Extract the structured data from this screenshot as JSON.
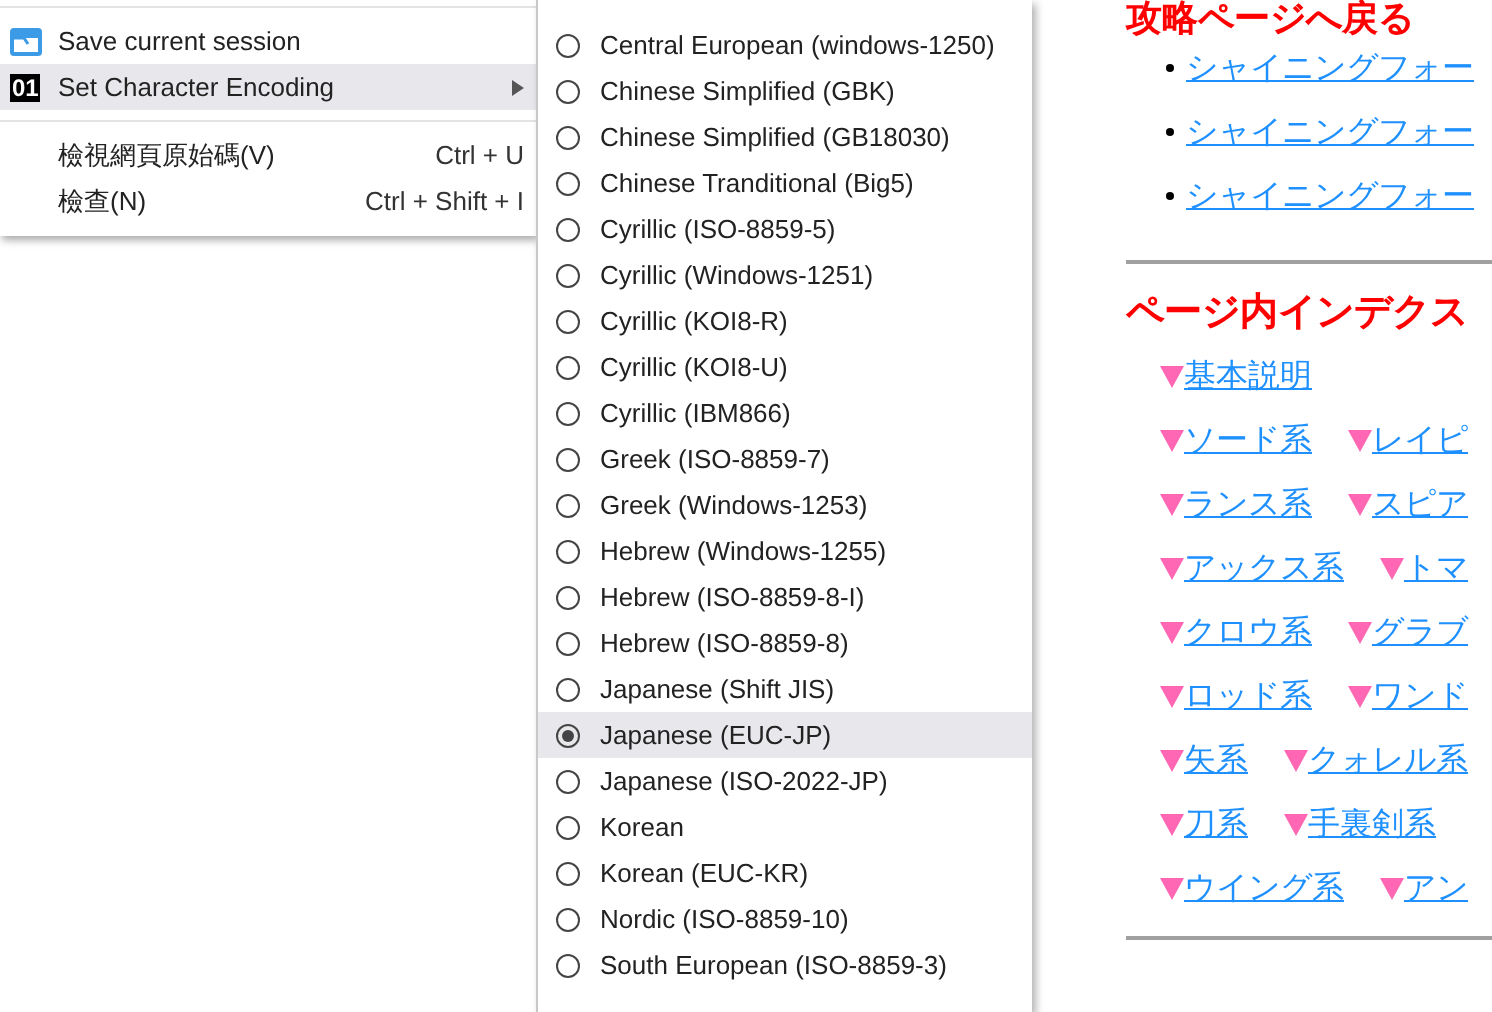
{
  "context_menu": {
    "items": [
      {
        "label": "Save current session",
        "kind": "icon",
        "highlighted": false,
        "submenu": false
      },
      {
        "label": "Set Character Encoding",
        "kind": "code",
        "icon_text": "01",
        "highlighted": true,
        "submenu": true
      },
      {
        "kind": "separator"
      },
      {
        "label": "檢視網頁原始碼(V)",
        "kind": "plain",
        "shortcut": "Ctrl + U",
        "highlighted": false,
        "submenu": false
      },
      {
        "label": "檢查(N)",
        "kind": "plain",
        "shortcut": "Ctrl + Shift + I",
        "highlighted": false,
        "submenu": false
      }
    ]
  },
  "encoding_submenu": {
    "items": [
      {
        "label": "Central European (windows-1250)",
        "selected": false
      },
      {
        "label": "Chinese Simplified (GBK)",
        "selected": false
      },
      {
        "label": "Chinese Simplified (GB18030)",
        "selected": false
      },
      {
        "label": "Chinese Tranditional (Big5)",
        "selected": false
      },
      {
        "label": "Cyrillic (ISO-8859-5)",
        "selected": false
      },
      {
        "label": "Cyrillic (Windows-1251)",
        "selected": false
      },
      {
        "label": "Cyrillic (KOI8-R)",
        "selected": false
      },
      {
        "label": "Cyrillic (KOI8-U)",
        "selected": false
      },
      {
        "label": "Cyrillic (IBM866)",
        "selected": false
      },
      {
        "label": "Greek (ISO-8859-7)",
        "selected": false
      },
      {
        "label": "Greek (Windows-1253)",
        "selected": false
      },
      {
        "label": "Hebrew (Windows-1255)",
        "selected": false
      },
      {
        "label": "Hebrew (ISO-8859-8-I)",
        "selected": false
      },
      {
        "label": "Hebrew (ISO-8859-8)",
        "selected": false
      },
      {
        "label": "Japanese (Shift JIS)",
        "selected": false
      },
      {
        "label": "Japanese (EUC-JP)",
        "selected": true
      },
      {
        "label": "Japanese (ISO-2022-JP)",
        "selected": false
      },
      {
        "label": "Korean",
        "selected": false
      },
      {
        "label": "Korean (EUC-KR)",
        "selected": false
      },
      {
        "label": "Nordic (ISO-8859-10)",
        "selected": false
      },
      {
        "label": "South European (ISO-8859-3)",
        "selected": false
      }
    ]
  },
  "page": {
    "back_heading": "攻略ページへ戻る",
    "back_links": [
      "シャイニングフォー",
      "シャイニングフォー",
      "シャイニングフォー"
    ],
    "index_heading": "ページ内インデクス",
    "index_rows": [
      [
        "基本説明"
      ],
      [
        "ソード系",
        "レイピ"
      ],
      [
        "ランス系",
        "スピア"
      ],
      [
        "アックス系",
        "トマ"
      ],
      [
        "クロウ系",
        "グラブ"
      ],
      [
        "ロッド系",
        "ワンド"
      ],
      [
        "矢系",
        "クォレル系"
      ],
      [
        "刀系",
        "手裏剣系"
      ],
      [
        "ウイング系",
        "アン"
      ]
    ]
  }
}
